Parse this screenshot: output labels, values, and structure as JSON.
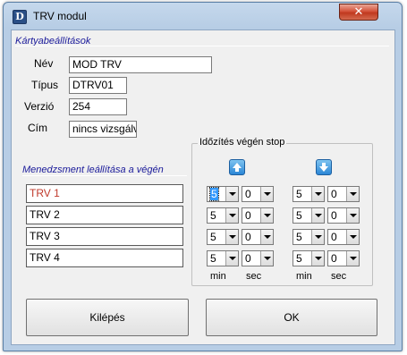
{
  "window": {
    "title": "TRV modul",
    "close_glyph": "✕"
  },
  "card_settings": {
    "section_title": "Kártyabeállítások",
    "fields": {
      "name": {
        "label": "Név",
        "value": "MOD TRV"
      },
      "type": {
        "label": "Típus",
        "value": "DTRV01"
      },
      "version": {
        "label": "Verzió",
        "value": "254"
      },
      "address": {
        "label": "Cím",
        "value": "nincs vizsgálva"
      }
    }
  },
  "management_section_title": "Menedzsment leállítása a végén",
  "timer_group": {
    "title": "Időzítés végén stop",
    "up_icon": "arrow-up-icon",
    "down_icon": "arrow-down-icon",
    "unit_labels": [
      "min",
      "sec",
      "min",
      "sec"
    ]
  },
  "trv_rows": [
    {
      "name": "TRV 1",
      "up_min": "5",
      "up_sec": "0",
      "down_min": "5",
      "down_sec": "0"
    },
    {
      "name": "TRV 2",
      "up_min": "5",
      "up_sec": "0",
      "down_min": "5",
      "down_sec": "0"
    },
    {
      "name": "TRV 3",
      "up_min": "5",
      "up_sec": "0",
      "down_min": "5",
      "down_sec": "0"
    },
    {
      "name": "TRV 4",
      "up_min": "5",
      "up_sec": "0",
      "down_min": "5",
      "down_sec": "0"
    }
  ],
  "buttons": {
    "exit": "Kilépés",
    "ok": "OK"
  },
  "colors": {
    "selected_row_text": "#c0392b",
    "section_label": "#1a1a9a"
  }
}
